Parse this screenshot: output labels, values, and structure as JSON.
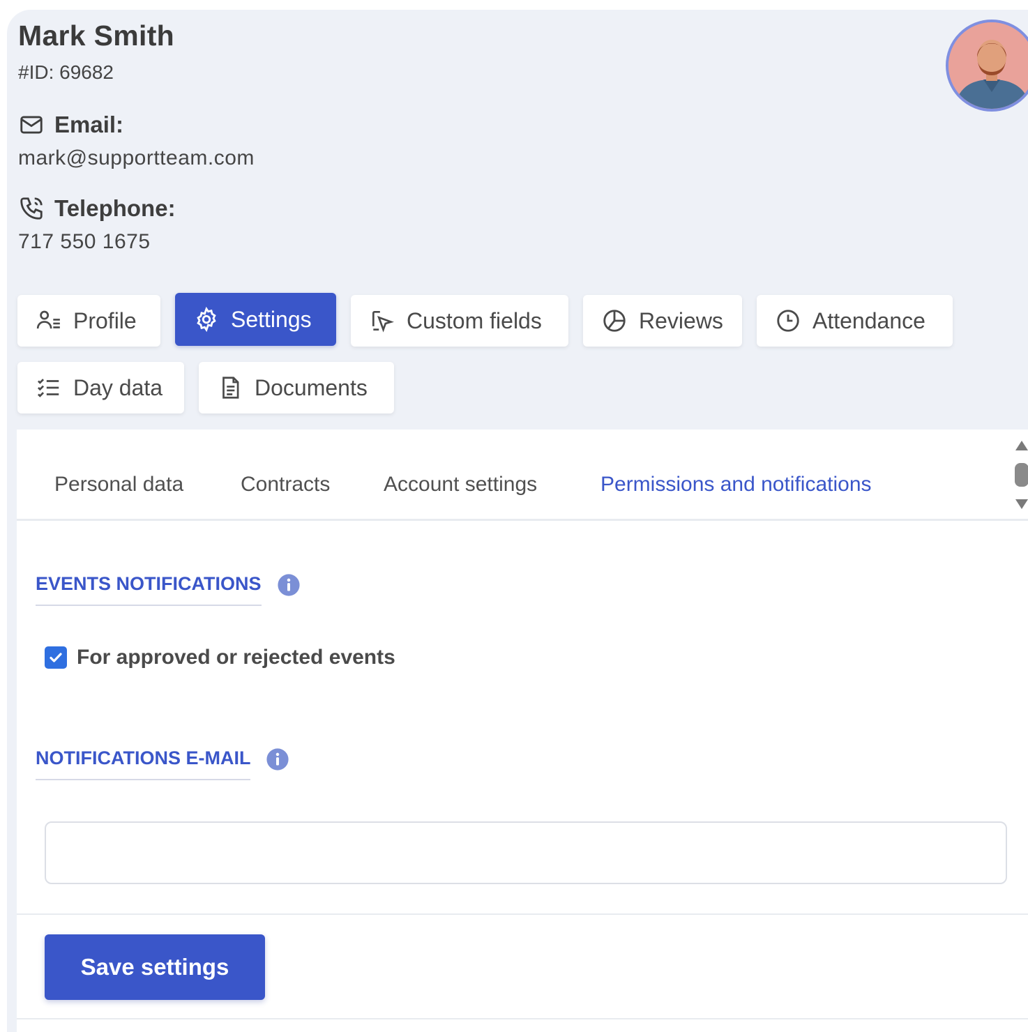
{
  "user": {
    "name": "Mark Smith",
    "id_text": "#ID: 69682",
    "email_label": "Email:",
    "email": "mark@supportteam.com",
    "telephone_label": "Telephone:",
    "telephone": "717 550 1675"
  },
  "main_tabs": [
    {
      "label": "Profile",
      "icon": "user-list-icon"
    },
    {
      "label": "Settings",
      "icon": "gear-icon",
      "active": true
    },
    {
      "label": "Custom fields",
      "icon": "cursor-edit-icon"
    },
    {
      "label": "Reviews",
      "icon": "pie-chart-icon"
    },
    {
      "label": "Attendance",
      "icon": "clock-icon"
    },
    {
      "label": "Day data",
      "icon": "checklist-icon"
    },
    {
      "label": "Documents",
      "icon": "document-icon"
    }
  ],
  "sub_tabs": [
    {
      "label": "Personal data"
    },
    {
      "label": "Contracts"
    },
    {
      "label": "Account settings"
    },
    {
      "label": "Permissions and notifications",
      "active": true
    }
  ],
  "events_notifications": {
    "title": "EVENTS NOTIFICATIONS",
    "checkbox_label": "For approved or rejected events",
    "checked": true
  },
  "notifications_email": {
    "title": "NOTIFICATIONS E-MAIL",
    "value": "",
    "placeholder": ""
  },
  "actions": {
    "save_label": "Save settings"
  },
  "colors": {
    "accent": "#3a56c9",
    "background": "#eef1f7",
    "checkbox": "#2f6fe0"
  }
}
